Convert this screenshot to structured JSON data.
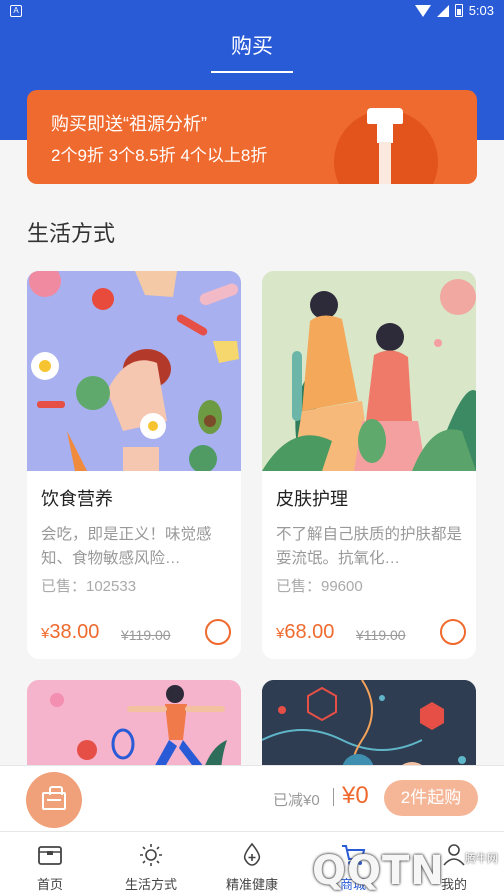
{
  "status_bar": {
    "time": "5:03",
    "notif_icon": "A"
  },
  "header": {
    "title": "购买"
  },
  "promo": {
    "line1": "购买即送“祖源分析”",
    "line2": "2个9折   3个8.5折   4个以上8折"
  },
  "section": {
    "title": "生活方式"
  },
  "products": [
    {
      "name": "饮食营养",
      "desc": "会吃，即是正义！味觉感知、食物敏感风险…",
      "sold": "已售：102533",
      "price_symbol": "¥",
      "price": "38.00",
      "original_price": "¥119.00"
    },
    {
      "name": "皮肤护理",
      "desc": "不了解自己肤质的护肤都是耍流氓。抗氧化…",
      "sold": "已售：99600",
      "price_symbol": "¥",
      "price": "68.00",
      "original_price": "¥119.00"
    }
  ],
  "cart": {
    "discount": "已减¥0",
    "total": "¥0",
    "buy_label": "2件起购"
  },
  "tabs": [
    {
      "label": "首页",
      "icon": "home-icon"
    },
    {
      "label": "生活方式",
      "icon": "sun-icon"
    },
    {
      "label": "精准健康",
      "icon": "drop-plus-icon"
    },
    {
      "label": "商城",
      "icon": "cart-icon"
    },
    {
      "label": "我的",
      "icon": "user-icon"
    }
  ],
  "watermark": {
    "text": "QQTN",
    "small": "腾牛网"
  },
  "colors": {
    "primary": "#2a5bd7",
    "accent": "#ef6a2e"
  }
}
